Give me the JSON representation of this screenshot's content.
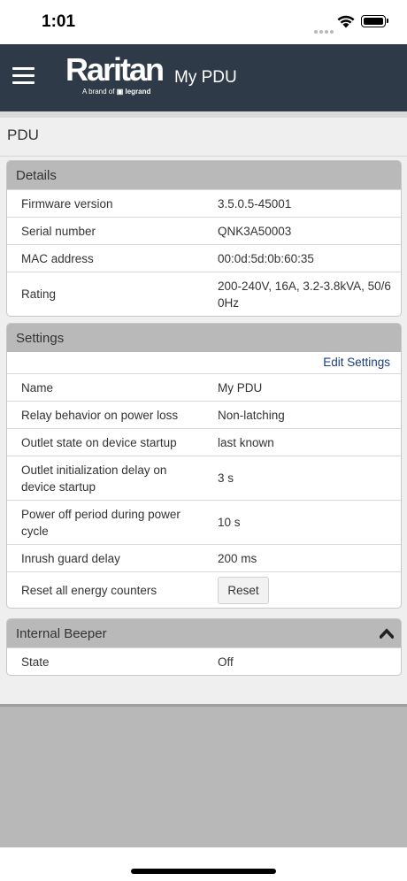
{
  "status": {
    "time": "1:01"
  },
  "nav": {
    "title": "My PDU",
    "logo_text": "Raritan",
    "logo_sub": "A brand of",
    "logo_brand": "legrand"
  },
  "page": {
    "title": "PDU"
  },
  "details": {
    "header": "Details",
    "rows": [
      {
        "label": "Firmware version",
        "value": "3.5.0.5-45001"
      },
      {
        "label": "Serial number",
        "value": "QNK3A50003"
      },
      {
        "label": "MAC address",
        "value": "00:0d:5d:0b:60:35"
      },
      {
        "label": "Rating",
        "value": "200-240V, 16A, 3.2-3.8kVA, 50/60Hz"
      }
    ]
  },
  "settings": {
    "header": "Settings",
    "edit_label": "Edit Settings",
    "rows": [
      {
        "label": "Name",
        "value": "My PDU"
      },
      {
        "label": "Relay behavior on power loss",
        "value": "Non-latching"
      },
      {
        "label": "Outlet state on device startup",
        "value": "last known"
      },
      {
        "label": "Outlet initialization delay on device startup",
        "value": "3 s"
      },
      {
        "label": "Power off period during power cycle",
        "value": "10 s"
      },
      {
        "label": "Inrush guard delay",
        "value": "200 ms"
      }
    ],
    "reset_label": "Reset all energy counters",
    "reset_button": "Reset"
  },
  "beeper": {
    "header": "Internal Beeper",
    "rows": [
      {
        "label": "State",
        "value": "Off"
      }
    ]
  },
  "icons": {
    "menu": "hamburger-menu-icon",
    "collapse": "chevron-up-icon",
    "wifi": "wifi-icon",
    "battery": "battery-icon"
  }
}
